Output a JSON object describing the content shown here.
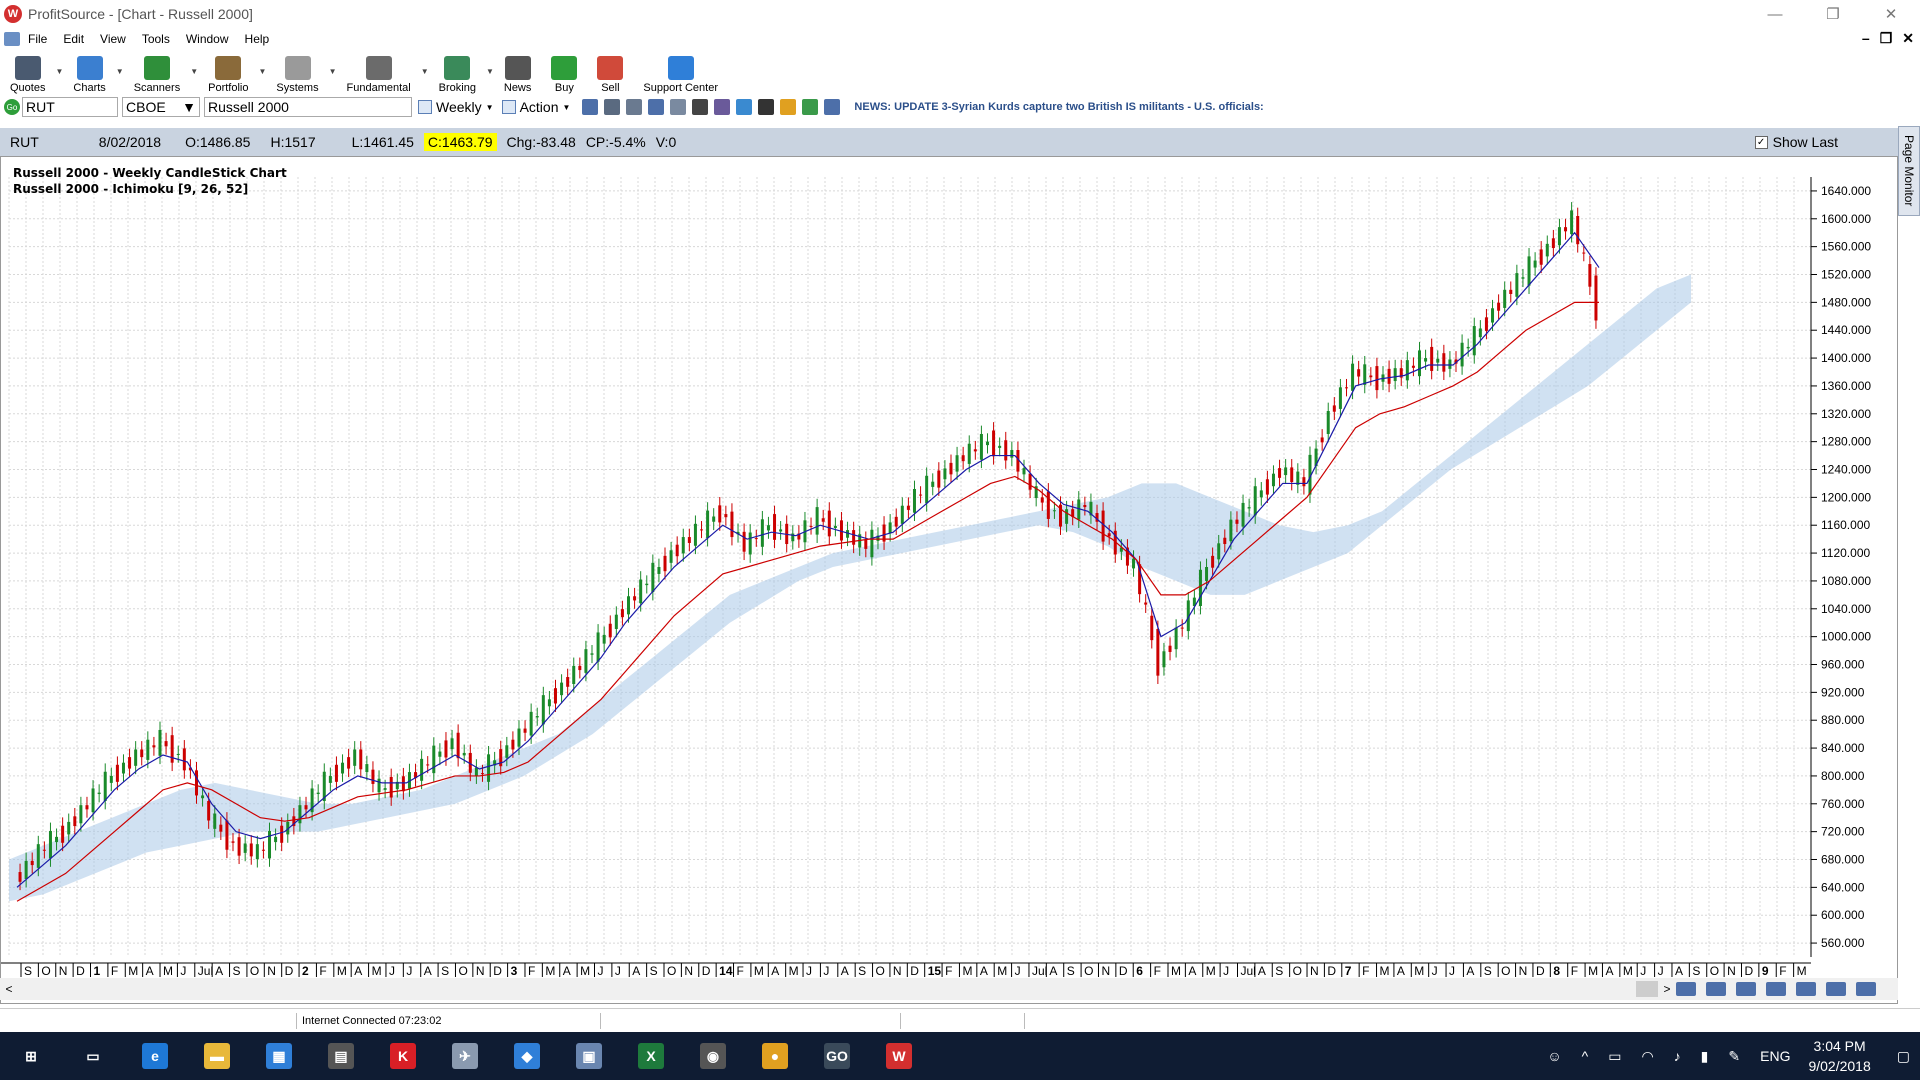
{
  "window": {
    "title": "ProfitSource - [Chart - Russell 2000]",
    "app_icon_letter": "W"
  },
  "menu": [
    "File",
    "Edit",
    "View",
    "Tools",
    "Window",
    "Help"
  ],
  "toolbar": [
    {
      "label": "Quotes",
      "color": "#4a5a70",
      "icon": "quotes-icon"
    },
    {
      "label": "Charts",
      "color": "#3b7fd0",
      "icon": "charts-icon"
    },
    {
      "label": "Scanners",
      "color": "#2f8f3a",
      "icon": "scanners-icon"
    },
    {
      "label": "Portfolio",
      "color": "#8a6a3a",
      "icon": "portfolio-icon"
    },
    {
      "label": "Systems",
      "color": "#9a9a9a",
      "icon": "systems-icon"
    },
    {
      "label": "Fundamental",
      "color": "#6b6b6b",
      "icon": "fundamental-icon"
    },
    {
      "label": "Broking",
      "color": "#3a8a5a",
      "icon": "broking-icon"
    },
    {
      "label": "News",
      "color": "#555555",
      "icon": "news-icon"
    },
    {
      "label": "Buy",
      "color": "#2e9e3a",
      "icon": "buy-icon"
    },
    {
      "label": "Sell",
      "color": "#d04a3a",
      "icon": "sell-icon"
    },
    {
      "label": "Support Center",
      "color": "#2f7fd8",
      "icon": "support-icon"
    }
  ],
  "symbolbar": {
    "go": "Go",
    "symbol": "RUT",
    "exchange": "CBOE",
    "name": "Russell 2000",
    "period": "Weekly",
    "action": "Action",
    "news": "NEWS: UPDATE 3-Syrian Kurds capture two British IS militants - U.S. officials:"
  },
  "quote": {
    "symbol": "RUT",
    "date": "8/02/2018",
    "open": "O:1486.85",
    "high": "H:1517",
    "low": "L:1461.45",
    "close": "C:1463.79",
    "change": "Chg:-83.48",
    "change_pct": "CP:-5.4%",
    "volume": "V:0",
    "show_last": "Show Last"
  },
  "page_monitor": "Page Monitor",
  "chart_data": {
    "type": "line",
    "title": "Russell 2000 - Weekly CandleStick Chart",
    "subtitle": "Russell 2000 - Ichimoku [9, 26, 52]",
    "ylim": [
      540,
      1660
    ],
    "y_ticks": [
      "560.000",
      "600.000",
      "640.000",
      "680.000",
      "720.000",
      "760.000",
      "800.000",
      "840.000",
      "880.000",
      "920.000",
      "960.000",
      "1000.000",
      "1040.000",
      "1080.000",
      "1120.000",
      "1160.000",
      "1200.000",
      "1240.000",
      "1280.000",
      "1320.000",
      "1360.000",
      "1400.000",
      "1440.000",
      "1480.000",
      "1520.000",
      "1560.000",
      "1600.000",
      "1640.000"
    ],
    "x_tick_labels": [
      "S",
      "O",
      "N",
      "D",
      "1",
      "F",
      "M",
      "A",
      "M",
      "J",
      "Jul",
      "A",
      "S",
      "O",
      "N",
      "D",
      "2",
      "F",
      "M",
      "A",
      "M",
      "J",
      "J",
      "A",
      "S",
      "O",
      "N",
      "D",
      "3",
      "F",
      "M",
      "A",
      "M",
      "J",
      "J",
      "A",
      "S",
      "O",
      "N",
      "D",
      "14",
      "F",
      "M",
      "A",
      "M",
      "J",
      "J",
      "A",
      "S",
      "O",
      "N",
      "D",
      "15",
      "F",
      "M",
      "A",
      "M",
      "J",
      "Jul",
      "A",
      "S",
      "O",
      "N",
      "D",
      "6",
      "F",
      "M",
      "A",
      "M",
      "J",
      "Jul",
      "A",
      "S",
      "O",
      "N",
      "D",
      "7",
      "F",
      "M",
      "A",
      "M",
      "J",
      "J",
      "A",
      "S",
      "O",
      "N",
      "D",
      "8",
      "F",
      "M",
      "A",
      "M",
      "J",
      "J",
      "A",
      "S",
      "O",
      "N",
      "D",
      "9",
      "F",
      "M"
    ],
    "grid": true,
    "series": [
      {
        "color": "#000000",
        "values": [
          650,
          690,
          720,
          760,
          800,
          830,
          850,
          820,
          740,
          700,
          690,
          720,
          760,
          800,
          830,
          780,
          790,
          820,
          850,
          800,
          830,
          870,
          910,
          950,
          990,
          1040,
          1080,
          1120,
          1150,
          1180,
          1130,
          1160,
          1140,
          1170,
          1150,
          1130,
          1160,
          1200,
          1230,
          1260,
          1280,
          1260,
          1200,
          1170,
          1190,
          1140,
          1100,
          960,
          1020,
          1100,
          1160,
          1200,
          1240,
          1220,
          1320,
          1380,
          1370,
          1380,
          1400,
          1390,
          1430,
          1480,
          1520,
          1560,
          1600,
          1470
        ]
      },
      {
        "color": "#1a1aa8",
        "values": [
          640,
          670,
          700,
          740,
          780,
          810,
          830,
          820,
          760,
          720,
          710,
          720,
          750,
          780,
          800,
          790,
          790,
          810,
          830,
          810,
          820,
          850,
          890,
          930,
          970,
          1020,
          1060,
          1100,
          1130,
          1160,
          1140,
          1150,
          1145,
          1160,
          1150,
          1140,
          1150,
          1180,
          1210,
          1240,
          1260,
          1260,
          1220,
          1190,
          1180,
          1150,
          1110,
          1000,
          1020,
          1080,
          1140,
          1180,
          1220,
          1220,
          1290,
          1360,
          1370,
          1375,
          1390,
          1390,
          1420,
          1460,
          1500,
          1540,
          1580,
          1530
        ]
      },
      {
        "color": "#cc0000",
        "values": [
          620,
          640,
          660,
          690,
          720,
          750,
          780,
          790,
          780,
          760,
          740,
          735,
          740,
          755,
          770,
          775,
          780,
          790,
          800,
          800,
          805,
          820,
          850,
          880,
          910,
          950,
          990,
          1030,
          1060,
          1090,
          1100,
          1110,
          1120,
          1130,
          1135,
          1140,
          1140,
          1160,
          1180,
          1200,
          1220,
          1230,
          1210,
          1180,
          1160,
          1140,
          1110,
          1060,
          1060,
          1080,
          1110,
          1140,
          1170,
          1200,
          1250,
          1300,
          1320,
          1330,
          1345,
          1360,
          1380,
          1410,
          1440,
          1460,
          1480,
          1480
        ]
      }
    ],
    "cloud": {
      "color": "#a9c9e8",
      "upper": [
        680,
        700,
        720,
        740,
        760,
        780,
        790,
        780,
        770,
        760,
        760,
        770,
        780,
        800,
        820,
        840,
        860,
        900,
        940,
        980,
        1020,
        1060,
        1080,
        1100,
        1120,
        1130,
        1140,
        1150,
        1160,
        1170,
        1180,
        1190,
        1200,
        1220,
        1220,
        1200,
        1180,
        1160,
        1150,
        1160,
        1180,
        1220,
        1260,
        1300,
        1340,
        1380,
        1420,
        1460,
        1500,
        1520
      ],
      "lower": [
        620,
        630,
        650,
        670,
        690,
        700,
        710,
        720,
        720,
        720,
        730,
        740,
        750,
        760,
        780,
        800,
        830,
        860,
        900,
        940,
        980,
        1020,
        1050,
        1080,
        1100,
        1110,
        1120,
        1130,
        1140,
        1150,
        1160,
        1150,
        1130,
        1100,
        1080,
        1060,
        1060,
        1080,
        1100,
        1120,
        1160,
        1200,
        1240,
        1270,
        1300,
        1330,
        1360,
        1400,
        1440,
        1480
      ]
    }
  },
  "status": {
    "connection": "Internet Connected 07:23:02"
  },
  "taskbar": {
    "apps": [
      {
        "name": "windows-start-icon",
        "glyph": "⊞",
        "color": ""
      },
      {
        "name": "task-view-icon",
        "glyph": "▭",
        "color": ""
      },
      {
        "name": "edge-icon",
        "glyph": "e",
        "color": "#1e78d6"
      },
      {
        "name": "file-explorer-icon",
        "glyph": "▬",
        "color": "#e8b83a"
      },
      {
        "name": "store-icon",
        "glyph": "▦",
        "color": "#2f7fd8"
      },
      {
        "name": "calculator-icon",
        "glyph": "▤",
        "color": "#555555"
      },
      {
        "name": "kaspersky-icon",
        "glyph": "K",
        "color": "#d81f26"
      },
      {
        "name": "app-icon-2",
        "glyph": "✈",
        "color": "#8a9ab0"
      },
      {
        "name": "defender-icon",
        "glyph": "◆",
        "color": "#2f7fd8"
      },
      {
        "name": "app-icon-3",
        "glyph": "▣",
        "color": "#6a86b0"
      },
      {
        "name": "excel-icon",
        "glyph": "X",
        "color": "#1e7a3c"
      },
      {
        "name": "camera-icon",
        "glyph": "◉",
        "color": "#555555"
      },
      {
        "name": "chrome-icon",
        "glyph": "●",
        "color": "#e0a020"
      },
      {
        "name": "app-icon-go",
        "glyph": "GO",
        "color": "#3a4a5a"
      },
      {
        "name": "profitsource-icon",
        "glyph": "W",
        "color": "#d32f2f"
      }
    ],
    "language": "ENG",
    "time": "3:04 PM",
    "date": "9/02/2018"
  }
}
